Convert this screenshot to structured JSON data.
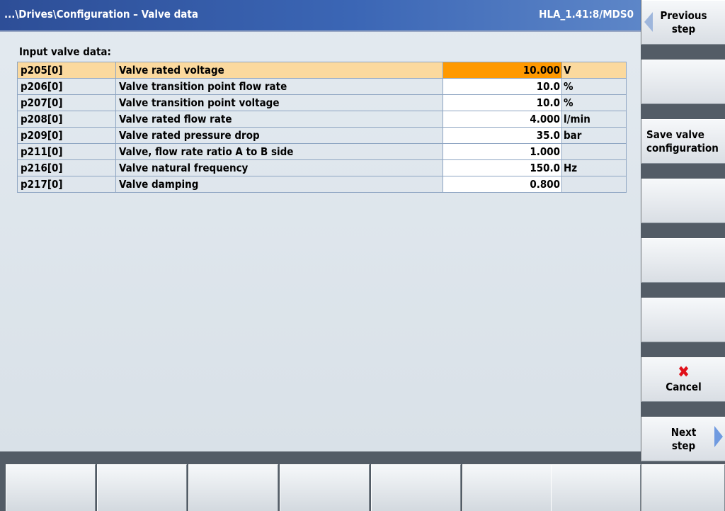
{
  "header": {
    "path": "...\\Drives\\Configuration – Valve data",
    "id": "HLA_1.41:8/MDS0"
  },
  "section_label": "Input valve data:",
  "params": [
    {
      "id": "p205[0]",
      "desc": "Valve rated voltage",
      "value": "10.000",
      "unit": "V",
      "selected": true
    },
    {
      "id": "p206[0]",
      "desc": "Valve transition point flow rate",
      "value": "10.0",
      "unit": "%"
    },
    {
      "id": "p207[0]",
      "desc": "Valve transition point voltage",
      "value": "10.0",
      "unit": "%"
    },
    {
      "id": "p208[0]",
      "desc": "Valve rated flow rate",
      "value": "4.000",
      "unit": "l/min"
    },
    {
      "id": "p209[0]",
      "desc": "Valve rated pressure drop",
      "value": "35.0",
      "unit": "bar"
    },
    {
      "id": "p211[0]",
      "desc": "Valve, flow rate ratio A to B side",
      "value": "1.000",
      "unit": ""
    },
    {
      "id": "p216[0]",
      "desc": "Valve natural frequency",
      "value": "150.0",
      "unit": "Hz"
    },
    {
      "id": "p217[0]",
      "desc": "Valve damping",
      "value": "0.800",
      "unit": ""
    }
  ],
  "softkeys": {
    "vsk1": "Previous\nstep",
    "vsk2": "",
    "vsk3": "Save valve\nconfiguration",
    "vsk4": "",
    "vsk5": "",
    "vsk6": "",
    "vsk7": "Cancel",
    "vsk8": "Next\nstep"
  },
  "colors": {
    "title_bar": "#3b66b5",
    "selected_value": "#ff9900",
    "selected_row": "#fbd99e",
    "cancel_icon": "#e0101a"
  }
}
